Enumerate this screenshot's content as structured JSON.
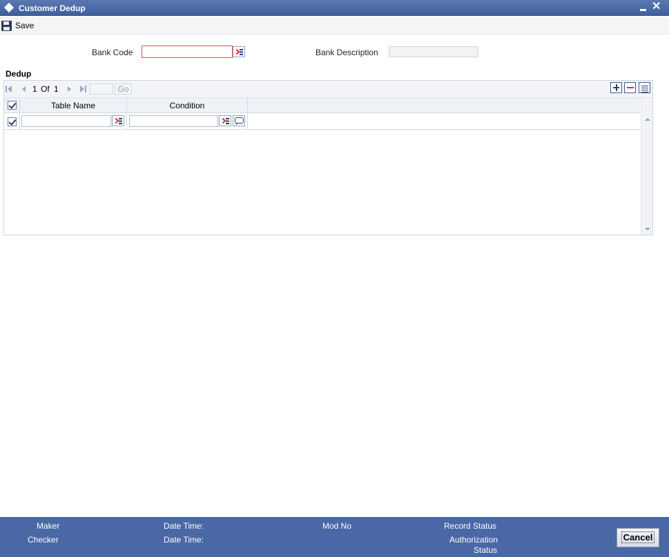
{
  "window": {
    "title": "Customer Dedup"
  },
  "toolbar": {
    "save_label": "Save"
  },
  "form": {
    "bank_code_label": "Bank Code",
    "bank_code_value": "",
    "bank_description_label": "Bank Description",
    "bank_description_value": ""
  },
  "dedup": {
    "section_title": "Dedup",
    "pager": {
      "current": "1",
      "of_label": "Of",
      "total": "1",
      "go_label": "Go",
      "page_input": ""
    },
    "columns": [
      "Table Name",
      "Condition"
    ],
    "rows": [
      {
        "checked": true,
        "table_name": "",
        "condition": ""
      }
    ]
  },
  "footer": {
    "maker_label": "Maker",
    "checker_label": "Checker",
    "date_time_label_1": "Date Time:",
    "date_time_label_2": "Date Time:",
    "mod_no_label": "Mod No",
    "record_status_label": "Record Status",
    "authorization_status_label_line1": "Authorization",
    "authorization_status_label_line2": "Status",
    "cancel_label": "Cancel"
  },
  "colors": {
    "titlebar": "#4a6aa8",
    "footer": "#4a68a5",
    "required_border": "#e44b4b"
  }
}
